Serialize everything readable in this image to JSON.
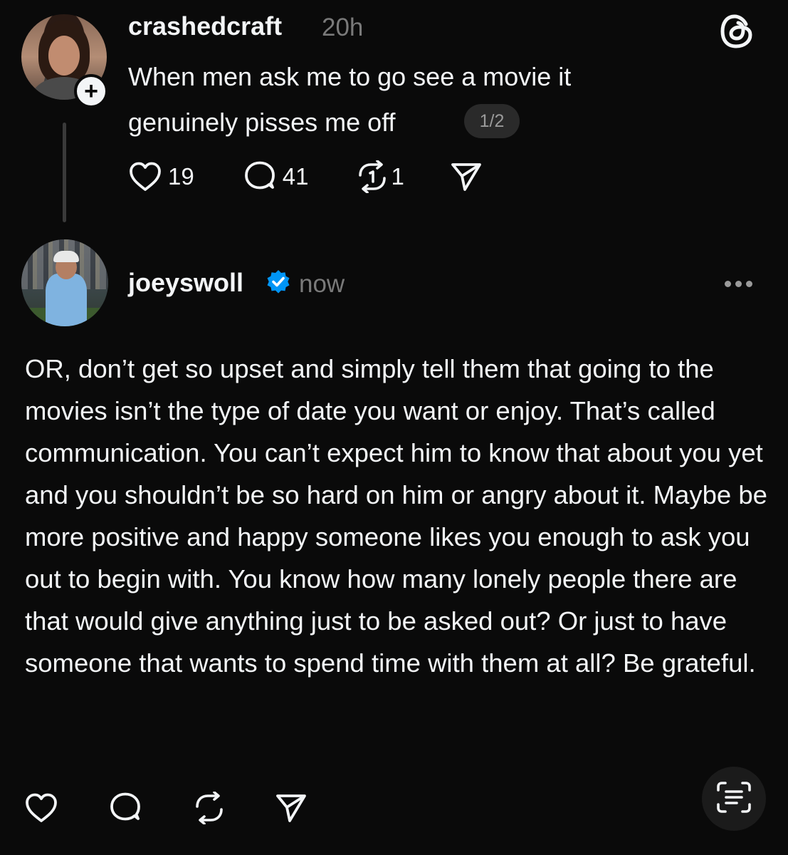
{
  "post1": {
    "username": "crashedcraft",
    "time": "20h",
    "text": "When men ask me to go see a movie it genuinely pisses me off",
    "page_indicator": "1/2",
    "follow_badge": "+",
    "likes": "19",
    "replies": "41",
    "reposts": "1"
  },
  "post2": {
    "username": "joeyswoll",
    "time": "now",
    "text": "OR, don’t get so upset and simply tell them that going to the movies isn’t the type of date you want or enjoy. That’s called communication. You can’t expect him to know that about you yet and you shouldn’t be so hard on him or angry about it. Maybe be more positive and happy someone likes you enough to ask you out to begin with. You know how many lonely people there are that would give anything just to be asked out? Or just to have someone that wants to spend time with them at all? Be grateful."
  },
  "icons": {
    "logo": "threads-logo-icon",
    "like": "heart-icon",
    "reply": "comment-icon",
    "repost": "repost-icon",
    "share": "send-icon",
    "verified": "verified-badge-icon",
    "more": "more-options-icon",
    "scan": "text-scan-icon"
  },
  "colors": {
    "background": "#0a0a0a",
    "text": "#f3f5f7",
    "muted": "#7a7a7a",
    "verified": "#0095f6"
  }
}
